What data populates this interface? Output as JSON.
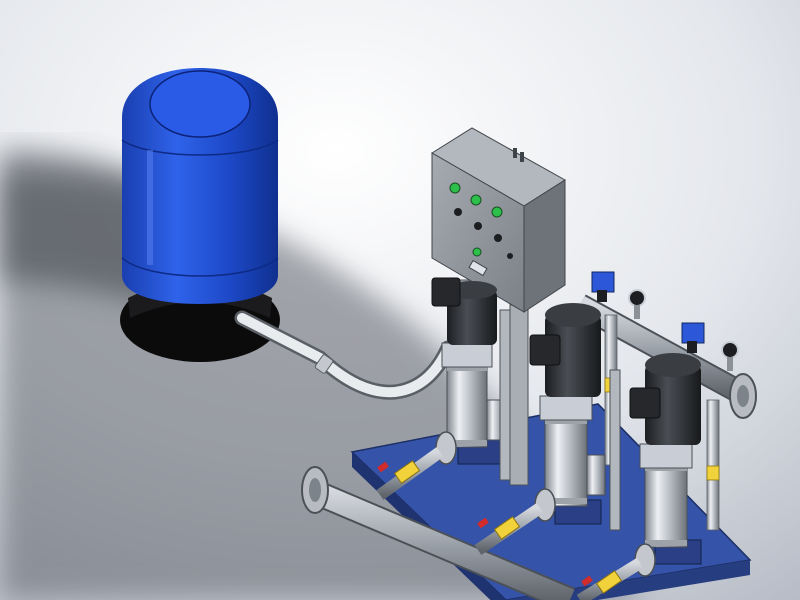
{
  "colors": {
    "background_light": "#ffffff",
    "background_dark": "#b9bfc9",
    "tank_blue": "#1f4fd6",
    "tank_blue_dark": "#0f2d9a",
    "pump_motor": "#2a2d31",
    "pump_steel": "#c9ced6",
    "control_box": "#8b9096",
    "base_plate": "#3553a8",
    "pipe_steel": "#9aa0a8",
    "valve_yellow": "#f2d23a",
    "valve_red": "#d12b2b",
    "switch_blue": "#2b57d8",
    "indicator_green": "#2cbf4a"
  },
  "icons": {
    "pressure_tank": "pressure-tank-icon",
    "control_cabinet": "control-cabinet-icon",
    "pump": "vertical-multistage-pump-icon",
    "pressure_switch": "pressure-switch-icon",
    "pressure_gauge": "pressure-gauge-icon",
    "valve": "ball-valve-icon",
    "flange": "pipe-flange-icon"
  },
  "scene": {
    "pump_count": 3,
    "panel_indicator_count": 3
  }
}
